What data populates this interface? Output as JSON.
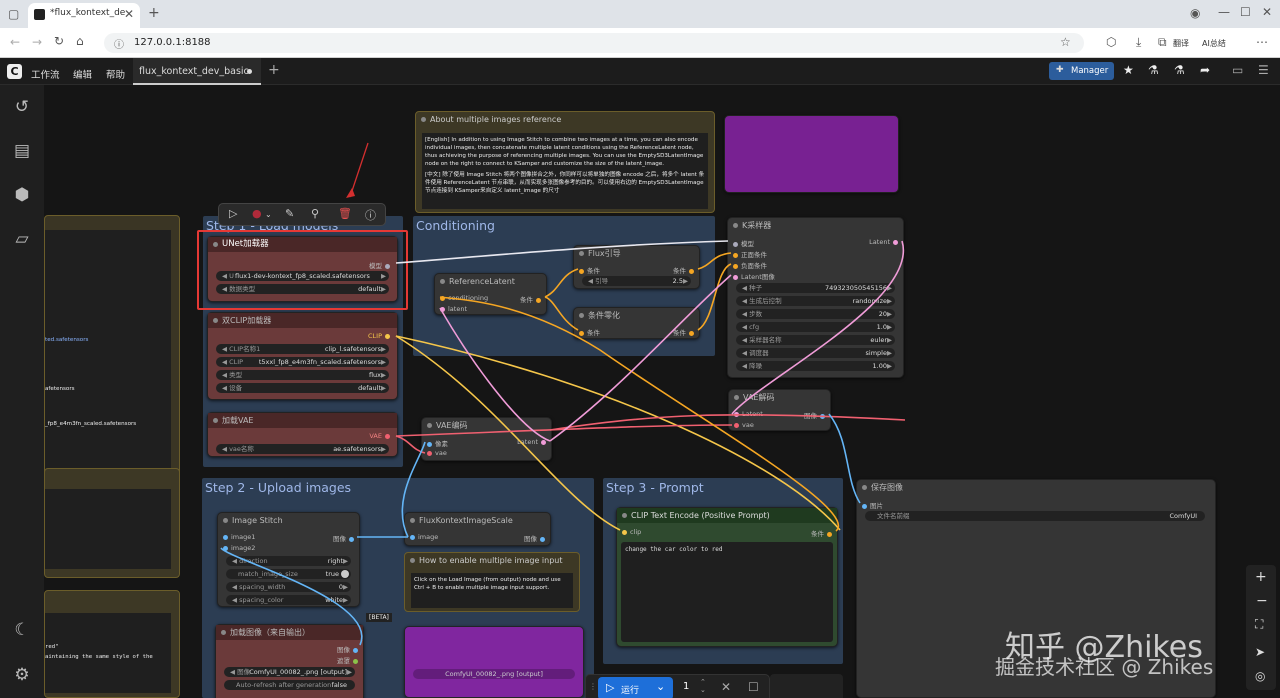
{
  "browser": {
    "tab_title": "*flux_kontext_de",
    "url": "127.0.0.1:8188",
    "translate": "翻译",
    "ai": "AI总结"
  },
  "menu": {
    "items": [
      "工作流",
      "编辑",
      "帮助"
    ],
    "workflow_tab": "flux_kontext_dev_basic",
    "manager": "Manager"
  },
  "groups": {
    "step1": "Step 1 - Load models",
    "conditioning": "Conditioning",
    "step2": "Step 2 - Upload images",
    "step3": "Step 3 - Prompt"
  },
  "note_about": {
    "title": "About multiple images reference",
    "en": "[English] In addition to using Image Stitch to combine two images at a time, you can also encode individual images, then concatenate multiple latent conditions using the ReferenceLatent node, thus achieving the purpose of referencing multiple images. You can use the EmptySD3LatentImage node on the right to connect to KSamper and customize the size of the latent_image.",
    "zh": "[中文] 除了使用 Image Stitch 将两个图像拼合之外，你同样可以将单独的图像 encode 之后，将多个 latent 条件使用 ReferenceLatent 节点串联，从而实现多张图像参考的目的。可以使用右边的 EmptySD3LatentImage 节点连接到 KSamper来自定义 latent_image 的尺寸"
  },
  "unet": {
    "title": "UNet加载器",
    "out": "模型",
    "w1": "U",
    "v1": "flux1-dev-kontext_fp8_scaled.safetensors",
    "w2": "数据类型",
    "v2": "default"
  },
  "clip": {
    "title": "双CLIP加载器",
    "out": "CLIP",
    "w1": "CLIP名称1",
    "v1": "clip_l.safetensors",
    "w2": "CLIP",
    "v2": "t5xxl_fp8_e4m3fn_scaled.safetensors",
    "w3": "类型",
    "v3": "flux",
    "w4": "设备",
    "v4": "default"
  },
  "vae": {
    "title": "加载VAE",
    "out": "VAE",
    "w1": "vae名称",
    "v1": "ae.safetensors"
  },
  "refl": {
    "title": "ReferenceLatent",
    "in1": "conditioning",
    "in2": "latent",
    "out": "条件"
  },
  "flux": {
    "title": "Flux引导",
    "in": "条件",
    "out": "条件",
    "w": "引导",
    "v": "2.5"
  },
  "zero": {
    "title": "条件零化",
    "in": "条件",
    "out": "条件"
  },
  "ksampler": {
    "title": "K采样器",
    "in": [
      "模型",
      "正面条件",
      "负面条件",
      "Latent图像"
    ],
    "out": "Latent",
    "widgets": [
      [
        "种子",
        "749323050545156"
      ],
      [
        "生成后控制",
        "randomize"
      ],
      [
        "步数",
        "20"
      ],
      [
        "cfg",
        "1.0"
      ],
      [
        "采样器名称",
        "euler"
      ],
      [
        "调度器",
        "simple"
      ],
      [
        "降噪",
        "1.00"
      ]
    ]
  },
  "vaeenc": {
    "title": "VAE编码",
    "in1": "像素",
    "in2": "vae",
    "out": "Latent"
  },
  "vaedec": {
    "title": "VAE解码",
    "in1": "Latent",
    "in2": "vae",
    "out": "图像"
  },
  "save": {
    "title": "保存图像",
    "in": "图片",
    "w": "文件名前缀",
    "v": "ComfyUI"
  },
  "stitch": {
    "title": "Image Stitch",
    "in1": "image1",
    "in2": "image2",
    "out": "图像",
    "widgets": [
      [
        "direction",
        "right"
      ],
      [
        "match_image_size",
        "true"
      ],
      [
        "spacing_width",
        "0"
      ],
      [
        "spacing_color",
        "white"
      ]
    ]
  },
  "scale": {
    "title": "FluxKontextImageScale",
    "in": "image",
    "out": "图像"
  },
  "note_how": {
    "title": "How to enable multiple image input",
    "body": "Click on the Load Image (from output) node and use Ctrl + B to enable multiple image input support."
  },
  "cliptext": {
    "title": "CLIP Text Encode (Positive Prompt)",
    "in": "clip",
    "out": "条件",
    "text": "change the car color to red"
  },
  "loadimg": {
    "title": "加载图像（来自输出）",
    "out1": "图像",
    "out2": "遮罩",
    "w1": "图像",
    "v1": "ComfyUI_00082_.png [output]",
    "w2": "Auto-refresh after generation",
    "v2": "false",
    "beta": "[BETA]"
  },
  "left_partial": {
    "t1": "ted.safetensors",
    "t2": "afetensors",
    "t3": "_fp8_e4m3fn_scaled.safetensors",
    "t4": "red\"",
    "t5": "aintaining the same style of the"
  },
  "ghost": {
    "t1": "ComfyUI_00082_.png [output]"
  },
  "run": {
    "label": "运行",
    "count": "1"
  },
  "watermark": {
    "w1": "知乎 @Zhikes",
    "w2": "掘金技术社区 @ Zhikes"
  },
  "colors": {
    "accent": "#1e6fd9",
    "highlight": "#e53935",
    "group_blue": "#2c3d53",
    "group_yellow": "#5a4f2a"
  }
}
